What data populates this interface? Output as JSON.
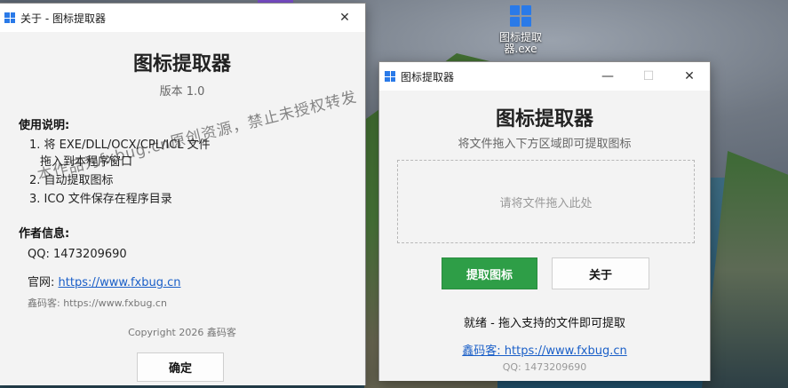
{
  "desktop": {
    "icon_label": "图标提取器.exe"
  },
  "about_window": {
    "title": "关于 - 图标提取器",
    "close_glyph": "✕",
    "app_name": "图标提取器",
    "version": "版本 1.0",
    "usage_heading": "使用说明:",
    "usage_lines": [
      "1. 将 EXE/DLL/OCX/CPL/ICL 文件",
      "拖入到本程序窗口",
      "2. 自动提取图标",
      "3. ICO 文件保存在程序目录"
    ],
    "author_heading": "作者信息:",
    "qq": "QQ: 1473209690",
    "website_label": "官网: ",
    "website_url": "https://www.fxbug.cn",
    "xinma": "鑫码客: https://www.fxbug.cn",
    "copyright": "Copyright 2026 鑫码客",
    "ok_button": "确定",
    "watermark": "本作品为fxbug.cn原创资源，禁止未授权转发"
  },
  "main_window": {
    "title": "图标提取器",
    "minimize_glyph": "—",
    "maximize_glyph": "☐",
    "close_glyph": "✕",
    "app_name": "图标提取器",
    "subtitle": "将文件拖入下方区域即可提取图标",
    "drop_placeholder": "请将文件拖入此处",
    "extract_button": "提取图标",
    "about_button": "关于",
    "status": "就绪 - 拖入支持的文件即可提取",
    "link": "鑫码客: https://www.fxbug.cn",
    "qq": "QQ: 1473209690"
  },
  "colors": {
    "accent_green": "#2e9e47",
    "link_blue": "#1a5fc8",
    "windows_blue": "#2a7ae8"
  }
}
